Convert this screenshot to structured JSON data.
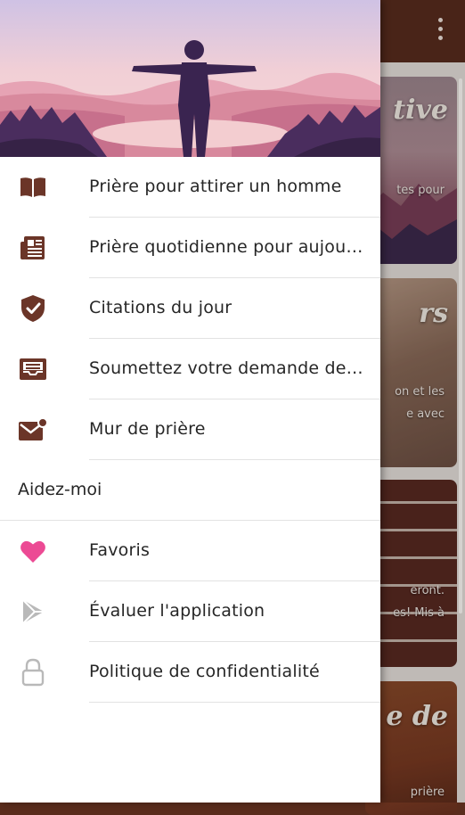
{
  "background": {
    "cards": [
      {
        "title": "tive",
        "text": "tes pour"
      },
      {
        "title": "rs",
        "text": "on et les\ne avec"
      },
      {
        "title": "",
        "text": "eront.\nes! Mis à"
      },
      {
        "title": "e de",
        "text": "prière"
      }
    ]
  },
  "drawer": {
    "items": [
      {
        "label": "Prière pour attirer un homme",
        "icon": "book-icon"
      },
      {
        "label": "Prière quotidienne pour aujourd'hui",
        "icon": "newspaper-icon"
      },
      {
        "label": "Citations du jour",
        "icon": "shield-check-icon"
      },
      {
        "label": "Soumettez votre demande de prière",
        "icon": "inbox-icon"
      },
      {
        "label": "Mur de prière",
        "icon": "mail-notification-icon"
      }
    ],
    "section_header": "Aidez-moi",
    "help_items": [
      {
        "label": "Favoris",
        "icon": "heart-icon"
      },
      {
        "label": "Évaluer l'application",
        "icon": "play-store-icon"
      },
      {
        "label": "Politique de confidentialité",
        "icon": "lock-icon"
      }
    ]
  },
  "colors": {
    "primary_dark": "#5a2d1e",
    "icon_brown": "#6b3528",
    "heart_pink": "#ec4a94",
    "muted_gray": "#b9b9b9"
  }
}
